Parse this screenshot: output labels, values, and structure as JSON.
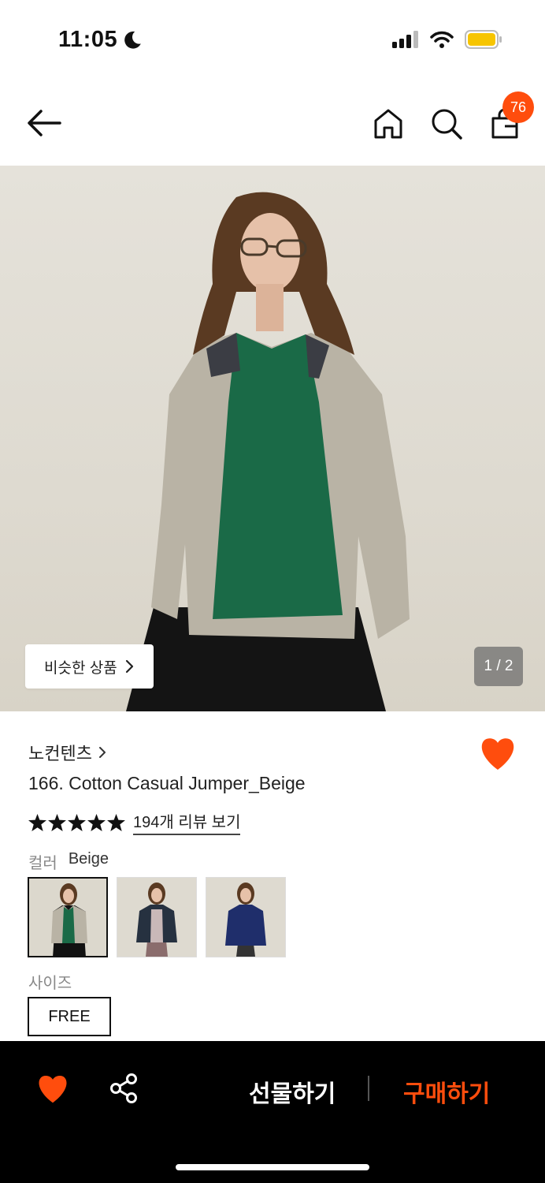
{
  "status_bar": {
    "time": "11:05",
    "moon_icon": "moon-icon",
    "battery_color": "#f7c500"
  },
  "nav": {
    "cart_count": "76",
    "icons": [
      "arrow-left-icon",
      "home-icon",
      "search-icon",
      "shopping-bag-icon"
    ]
  },
  "hero": {
    "similar_label": "비슷한 상품",
    "pager": "1 / 2"
  },
  "product": {
    "brand": "노컨텐츠",
    "title": "166. Cotton Casual Jumper_Beige",
    "rating_stars": 5,
    "review_link": "194개 리뷰 보기",
    "color_label": "컬러",
    "color_value": "Beige",
    "swatches": [
      "beige",
      "black",
      "navy"
    ],
    "size_label": "사이즈",
    "size_option": "FREE"
  },
  "bottom_bar": {
    "gift_label": "선물하기",
    "buy_label": "구매하기"
  },
  "colors": {
    "accent": "#ff4d0d",
    "bottom_bar_bg": "#000000"
  }
}
